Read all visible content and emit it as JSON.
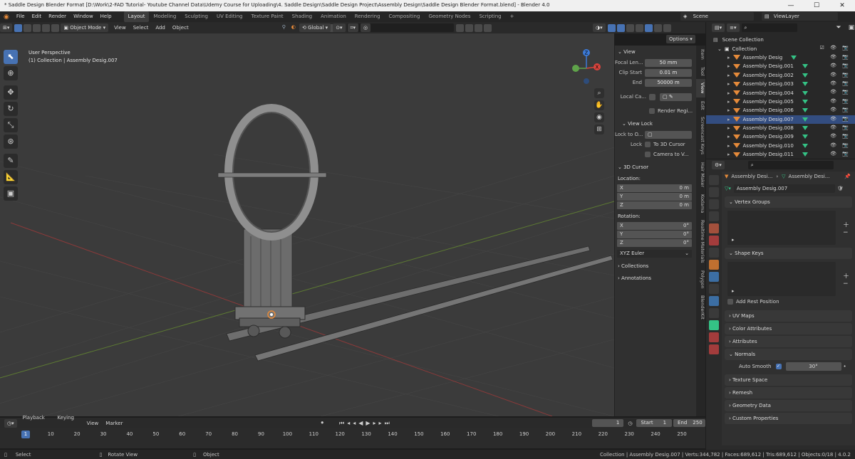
{
  "window": {
    "title": "* Saddle Design Blender Format [D:\\Work\\2-FAD Tutorial- Youtube Channel Data\\Udemy Course for Uploading\\4. Saddle Design\\Saddle Design Project\\Assembly Design\\Saddle Design Blender Format.blend] - Blender 4.0"
  },
  "menu": [
    "File",
    "Edit",
    "Render",
    "Window",
    "Help"
  ],
  "workspaces": [
    "Layout",
    "Modeling",
    "Sculpting",
    "UV Editing",
    "Texture Paint",
    "Shading",
    "Animation",
    "Rendering",
    "Compositing",
    "Geometry Nodes",
    "Scripting"
  ],
  "add_ws": "+",
  "scene": {
    "label": "Scene",
    "viewlayer": "ViewLayer"
  },
  "vpheader": {
    "mode": "Object Mode",
    "view": "View",
    "select": "Select",
    "add": "Add",
    "object": "Object",
    "transform": "Global",
    "options": "Options"
  },
  "viewport": {
    "perspective": "User Perspective",
    "collection_label": "(1) Collection | Assembly Desig.007",
    "axis_x": "X",
    "axis_y": "Y",
    "axis_z": "Z"
  },
  "npanel": {
    "view": "View",
    "focal_label": "Focal Len...",
    "focal": "50 mm",
    "clip_start_label": "Clip Start",
    "clip_start": "0.01 m",
    "end_label": "End",
    "end": "50000 m",
    "local_cam": "Local Ca...",
    "render_region": "Render Regi...",
    "view_lock": "View Lock",
    "lock_to": "Lock to O...",
    "lock": "Lock",
    "to_3d_cursor": "To 3D Cursor",
    "camera_to_v": "Camera to V...",
    "cursor": "3D Cursor",
    "location": "Location:",
    "loc": [
      {
        "axis": "X",
        "v": "0 m"
      },
      {
        "axis": "Y",
        "v": "0 m"
      },
      {
        "axis": "Z",
        "v": "0 m"
      }
    ],
    "rotation": "Rotation:",
    "rot": [
      {
        "axis": "X",
        "v": "0°"
      },
      {
        "axis": "Y",
        "v": "0°"
      },
      {
        "axis": "Z",
        "v": "0°"
      }
    ],
    "euler": "XYZ Euler",
    "collections": "Collections",
    "annotations": "Annotations"
  },
  "ntabs": [
    "Item",
    "Tool",
    "View",
    "Edit",
    "Screencast Keys",
    "Hair Maker",
    "Kodama",
    "Realtime Materials",
    "Polygon",
    "BlenderKit"
  ],
  "outliner": {
    "scene_collection": "Scene Collection",
    "collection": "Collection",
    "items": [
      "Assembly Desig",
      "Assembly Desig.001",
      "Assembly Desig.002",
      "Assembly Desig.003",
      "Assembly Desig.004",
      "Assembly Desig.005",
      "Assembly Desig.006",
      "Assembly Desig.007",
      "Assembly Desig.008",
      "Assembly Desig.009",
      "Assembly Desig.010",
      "Assembly Desig.011"
    ],
    "selected_index": 7
  },
  "props": {
    "breadcrumb_a": "Assembly Desi...",
    "breadcrumb_b": "Assembly Desi...",
    "mesh_name": "Assembly Desig.007",
    "vertex_groups": "Vertex Groups",
    "shape_keys": "Shape Keys",
    "add_rest": "Add Rest Position",
    "uv_maps": "UV Maps",
    "color_attributes": "Color Attributes",
    "attributes": "Attributes",
    "normals": "Normals",
    "auto_smooth": "Auto Smooth",
    "auto_smooth_angle": "30°",
    "texture_space": "Texture Space",
    "remesh": "Remesh",
    "geometry_data": "Geometry Data",
    "custom_properties": "Custom Properties"
  },
  "timeline": {
    "playback": "Playback",
    "keying": "Keying",
    "view": "View",
    "marker": "Marker",
    "current": "1",
    "start_label": "Start",
    "start": "1",
    "end_label": "End",
    "end": "250",
    "ticks": [
      "1",
      "10",
      "20",
      "30",
      "40",
      "50",
      "60",
      "70",
      "80",
      "90",
      "100",
      "110",
      "120",
      "130",
      "140",
      "150",
      "160",
      "170",
      "180",
      "190",
      "200",
      "210",
      "220",
      "230",
      "240",
      "250"
    ]
  },
  "status": {
    "select": "Select",
    "rotate": "Rotate View",
    "object": "Object",
    "stats": "Collection | Assembly Desig.007 | Verts:344,782 | Faces:689,612 | Tris:689,612 | Objects:0/18 | 4.0.2"
  },
  "colors": {
    "accent": "#4772b3",
    "selected_row": "#334d80",
    "mesh_orange": "#e58a3a",
    "vgroup_green": "#34c285"
  }
}
